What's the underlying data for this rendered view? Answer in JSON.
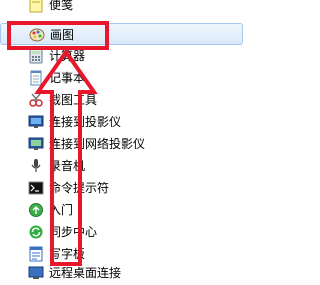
{
  "menu": {
    "items": [
      {
        "label": "便笺",
        "icon": "sticky-note-icon"
      },
      {
        "label": "画图",
        "icon": "paint-palette-icon"
      },
      {
        "label": "计算器",
        "icon": "calculator-icon"
      },
      {
        "label": "记事本",
        "icon": "notepad-icon"
      },
      {
        "label": "截图工具",
        "icon": "snipping-tool-icon"
      },
      {
        "label": "连接到投影仪",
        "icon": "projector-icon"
      },
      {
        "label": "连接到网络投影仪",
        "icon": "network-projector-icon"
      },
      {
        "label": "录音机",
        "icon": "microphone-icon"
      },
      {
        "label": "命令提示符",
        "icon": "command-prompt-icon"
      },
      {
        "label": "入门",
        "icon": "getting-started-icon"
      },
      {
        "label": "同步中心",
        "icon": "sync-center-icon"
      },
      {
        "label": "写字板",
        "icon": "wordpad-icon"
      },
      {
        "label": "远程桌面连接",
        "icon": "remote-desktop-icon"
      }
    ],
    "highlighted_index": 1
  },
  "colors": {
    "annotation_red": "#e8172b",
    "highlight_border": "#a7c7ee"
  }
}
